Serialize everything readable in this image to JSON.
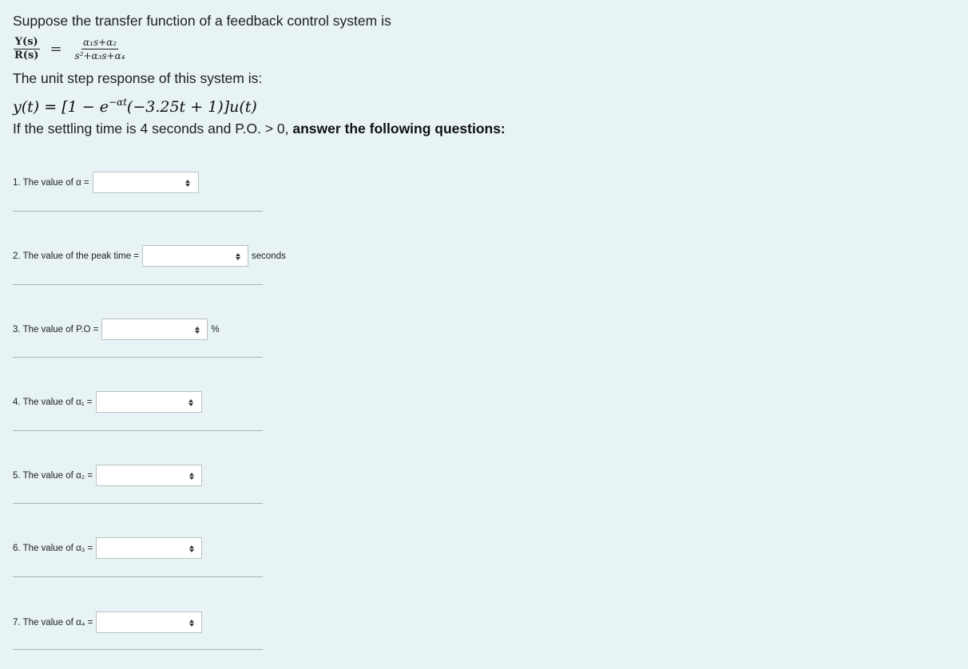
{
  "problem": {
    "line1": "Suppose the transfer function of a feedback control system is",
    "tf_left_num": "Y(s)",
    "tf_left_den": "R(s)",
    "tf_eq": "=",
    "tf_right_num": "α₁s+α₂",
    "tf_right_den": "s²+α₃s+α₄",
    "line2": "The unit step response of this system is:",
    "response_main": "y(t) = [1 − e",
    "response_exp": "−αt",
    "response_tail": "(−3.25t + 1)]u(t)",
    "line3_plain": "If the settling time is 4 seconds and P.O. > 0, ",
    "line3_bold": "answer the following questions:"
  },
  "questions": [
    {
      "label": "1. The value of α =",
      "unit": ""
    },
    {
      "label": "2. The value of the peak time  =",
      "unit": "seconds"
    },
    {
      "label": "3. The value of P.O =",
      "unit": "%"
    },
    {
      "label": "4. The value of α₁ =",
      "unit": ""
    },
    {
      "label": "5. The value of α₂ =",
      "unit": ""
    },
    {
      "label": "6. The value of α₃ =",
      "unit": ""
    },
    {
      "label": "7. The value of α₄ =",
      "unit": ""
    }
  ],
  "selects": {
    "q1": "",
    "q2": "",
    "q3": "",
    "q4": "",
    "q5": "",
    "q6": "",
    "q7": ""
  },
  "icons": {
    "select_arrow": "up-down-chevron-icon"
  },
  "colors": {
    "background": "#e7f3f5",
    "select_bg": "#ffffff",
    "divider": "#a9b3b5"
  }
}
